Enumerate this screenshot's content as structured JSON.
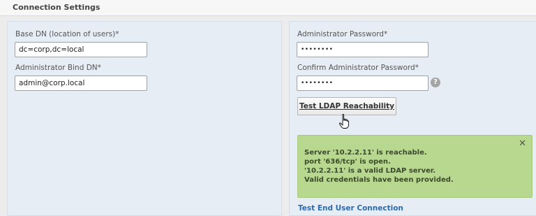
{
  "header": {
    "title": "Connection Settings"
  },
  "left_panel": {
    "base_dn_label": "Base DN (location of users)*",
    "base_dn_value": "dc=corp,dc=local",
    "bind_dn_label": "Administrator Bind DN*",
    "bind_dn_value": "admin@corp.local"
  },
  "right_panel": {
    "admin_password_label": "Administrator Password*",
    "admin_password_value": "••••••••",
    "confirm_password_label": "Confirm Administrator Password*",
    "confirm_password_value": "••••••••",
    "test_button_label": "Test LDAP Reachability",
    "help_icon_glyph": "?",
    "alert": {
      "close_glyph": "✕",
      "lines": [
        "Server '10.2.2.11' is reachable.",
        "port '636/tcp' is open.",
        "'10.2.2.11' is a valid LDAP server.",
        "Valid credentials have been provided."
      ],
      "background_color": "#b9d88f"
    },
    "test_end_user_link": "Test End User Connection"
  },
  "icons": {
    "help": "help-icon",
    "close": "close-icon",
    "cursor": "hand-pointer-icon"
  }
}
